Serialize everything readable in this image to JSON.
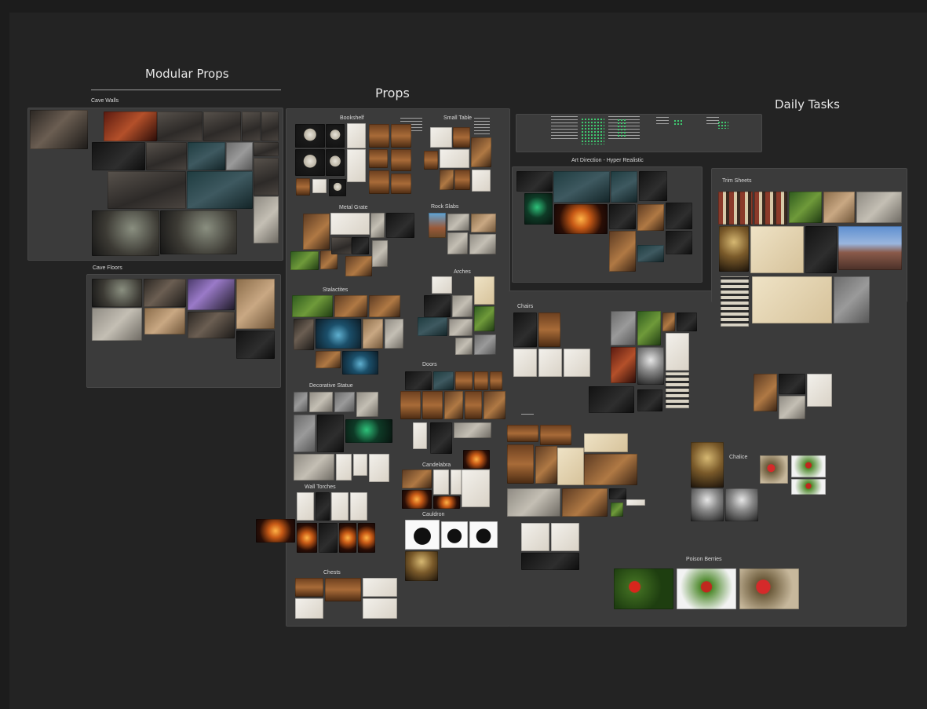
{
  "titles": {
    "modular_props": "Modular Props",
    "props": "Props",
    "daily_tasks": "Daily Tasks"
  },
  "labels": {
    "cave_walls": "Cave Walls",
    "cave_floors": "Cave Floors",
    "bookshelf": "Bookshelf",
    "small_table": "Small Table",
    "metal_grate": "Metal Grate",
    "rock_slabs": "Rock Slabs",
    "stalactites": "Stalactites",
    "arches": "Arches",
    "doors": "Doors",
    "decorative_statue": "Decorative Statue",
    "candelabra": "Candelabra",
    "wall_torches": "Wall Torches",
    "cauldron": "Cauldron",
    "chests": "Chests",
    "chairs": "Chairs",
    "art_direction": "Art Direction - Hyper Realistic",
    "trim_sheets": "Trim Sheets",
    "chalice": "Chalice",
    "poison_berries": "Poison Berries"
  },
  "colors": {
    "background": "#1c1c1c",
    "board": "#232323",
    "panel": "#3b3b3b",
    "text": "#e6e6e6"
  }
}
